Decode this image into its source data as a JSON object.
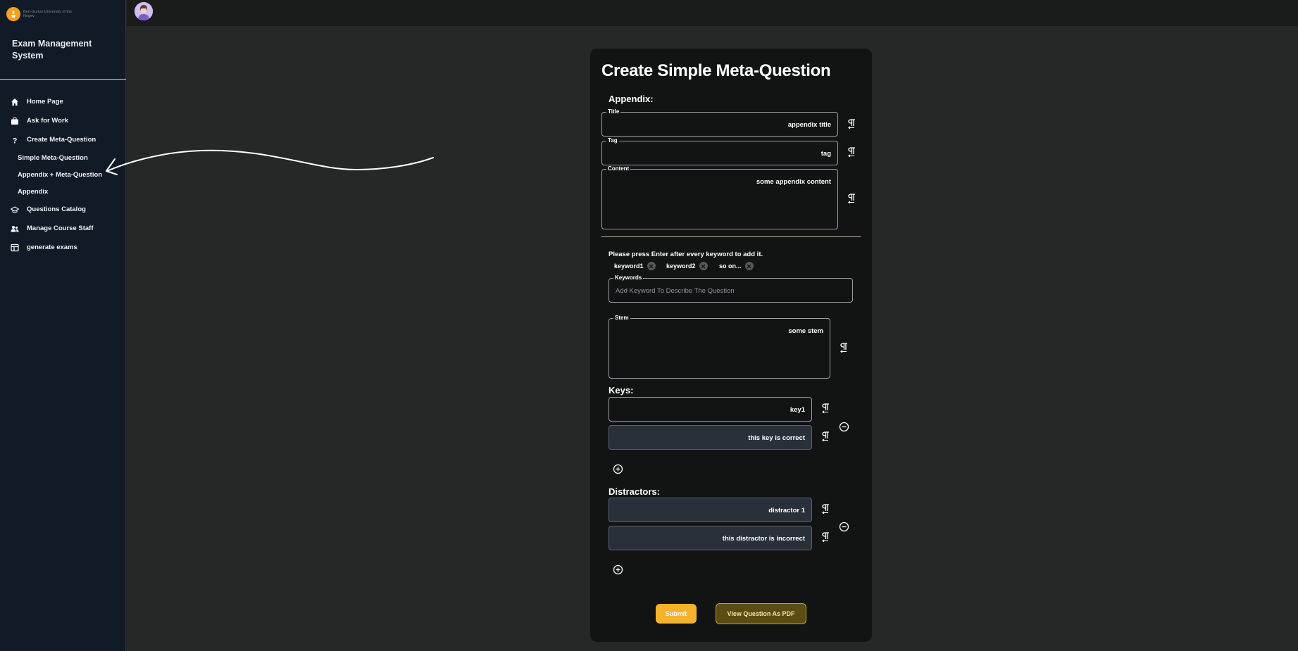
{
  "sidebar": {
    "logo_text": "Ben-Gurion University of the Negev",
    "app_title": "Exam Management System",
    "items": [
      {
        "label": "Home Page",
        "icon": "home-icon"
      },
      {
        "label": "Ask for Work",
        "icon": "briefcase-icon"
      },
      {
        "label": "Create Meta-Question",
        "icon": "question-icon"
      }
    ],
    "sub_items": [
      {
        "label": "Simple Meta-Question"
      },
      {
        "label": "Appendix + Meta-Question"
      },
      {
        "label": "Appendix"
      }
    ],
    "items_after": [
      {
        "label": "Questions Catalog",
        "icon": "graduation-cap-icon"
      },
      {
        "label": "Manage Course Staff",
        "icon": "people-icon"
      },
      {
        "label": "generate exams",
        "icon": "table-icon"
      }
    ]
  },
  "page": {
    "title": "Create Simple Meta-Question",
    "appendix_heading": "Appendix:",
    "appendix": {
      "title_legend": "Title",
      "title_value": "appendix title",
      "tag_legend": "Tag",
      "tag_value": "tag",
      "content_legend": "Content",
      "content_value": "some appendix content"
    },
    "keyword_hint": "Please press Enter after every keyword to add it.",
    "keywords": [
      "keyword1",
      "keyword2",
      "so on..."
    ],
    "keywords_legend": "Keywords",
    "keywords_placeholder": "Add Keyword To Describe The Question",
    "stem_legend": "Stem",
    "stem_value": "some stem",
    "keys_heading": "Keys:",
    "keys": [
      "key1",
      "this key is correct"
    ],
    "distractors_heading": "Distractors:",
    "distractors": [
      "distractor 1",
      "this distractor is incorrect"
    ],
    "submit_label": "Submit",
    "pdf_label": "View Question As PDF"
  },
  "colors": {
    "sidebar_bg": "#111a27",
    "page_bg": "#262727",
    "card_bg": "#121313",
    "submit": "#f6b22b",
    "pdf_bg": "#5a4c12",
    "logo": "#f5a11c"
  }
}
